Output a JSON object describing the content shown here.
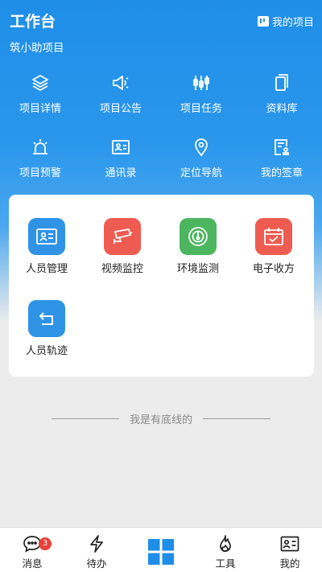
{
  "header": {
    "title": "工作台",
    "my_project": "我的项目",
    "subtitle": "筑小助项目"
  },
  "top_grid": [
    {
      "label": "项目详情",
      "icon": "layers-icon"
    },
    {
      "label": "项目公告",
      "icon": "megaphone-icon"
    },
    {
      "label": "项目任务",
      "icon": "sliders-icon"
    },
    {
      "label": "资料库",
      "icon": "documents-icon"
    },
    {
      "label": "项目预警",
      "icon": "alarm-light-icon"
    },
    {
      "label": "通讯录",
      "icon": "contact-card-icon"
    },
    {
      "label": "定位导航",
      "icon": "location-pin-icon"
    },
    {
      "label": "我的签章",
      "icon": "seal-document-icon"
    }
  ],
  "apps": [
    {
      "label": "人员管理",
      "icon": "id-card-icon",
      "color": "#2f93e6"
    },
    {
      "label": "视频监控",
      "icon": "cctv-camera-icon",
      "color": "#ee5b51"
    },
    {
      "label": "环境监测",
      "icon": "gauge-icon",
      "color": "#4bb65e"
    },
    {
      "label": "电子收方",
      "icon": "calendar-check-icon",
      "color": "#ee5b51"
    },
    {
      "label": "人员轨迹",
      "icon": "return-arrow-icon",
      "color": "#2f93e6"
    }
  ],
  "footer_note": "我是有底线的",
  "tabbar": {
    "messages": {
      "label": "消息",
      "badge": "3",
      "icon": "chat-bubble-icon"
    },
    "todo": {
      "label": "待办",
      "icon": "lightning-icon"
    },
    "home": {
      "icon": "grid-icon",
      "color": "#1f8ee8"
    },
    "tools": {
      "label": "工具",
      "icon": "flame-icon"
    },
    "mine": {
      "label": "我的",
      "icon": "profile-card-icon"
    }
  }
}
